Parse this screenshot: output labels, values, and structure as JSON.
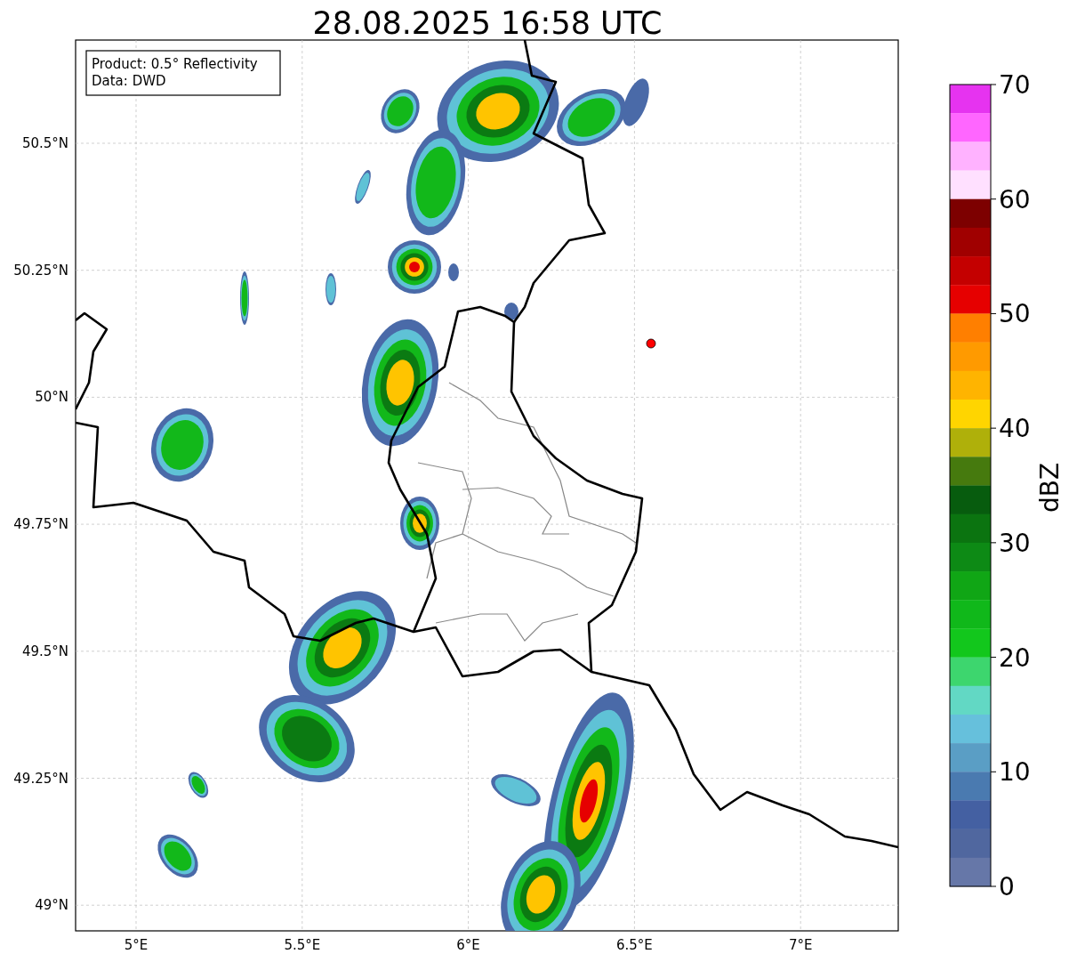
{
  "title": "28.08.2025 16:58 UTC",
  "info_box": [
    "Product: 0.5° Reflectivity",
    "Data: DWD"
  ],
  "map": {
    "x_ticks": [
      "5°E",
      "5.5°E",
      "6°E",
      "6.5°E",
      "7°E"
    ],
    "y_ticks": [
      "50.5°N",
      "50.25°N",
      "50°N",
      "49.75°N",
      "49.5°N",
      "49.25°N",
      "49°N"
    ]
  },
  "colorbar": {
    "label": "dBZ",
    "ticks": [
      "70",
      "60",
      "50",
      "40",
      "30",
      "20",
      "10",
      "0"
    ],
    "bands": [
      {
        "color": "#e633f0"
      },
      {
        "color": "#ff66ff"
      },
      {
        "color": "#ffb2ff"
      },
      {
        "color": "#ffe0ff"
      },
      {
        "color": "#7d0000"
      },
      {
        "color": "#a00000"
      },
      {
        "color": "#c40000"
      },
      {
        "color": "#e60000"
      },
      {
        "color": "#ff7f00"
      },
      {
        "color": "#ff9a00"
      },
      {
        "color": "#ffb400"
      },
      {
        "color": "#ffd500"
      },
      {
        "color": "#afb00a"
      },
      {
        "color": "#467a0e"
      },
      {
        "color": "#075c0e"
      },
      {
        "color": "#0b7410"
      },
      {
        "color": "#0d8a15"
      },
      {
        "color": "#10a615"
      },
      {
        "color": "#10b81a"
      },
      {
        "color": "#12c71c"
      },
      {
        "color": "#3dd66e"
      },
      {
        "color": "#62d8c4"
      },
      {
        "color": "#66c0dc"
      },
      {
        "color": "#5a9ec5"
      },
      {
        "color": "#4a7ab0"
      },
      {
        "color": "#4460a2"
      },
      {
        "color": "#50679f"
      },
      {
        "color": "#6677a8"
      }
    ]
  }
}
